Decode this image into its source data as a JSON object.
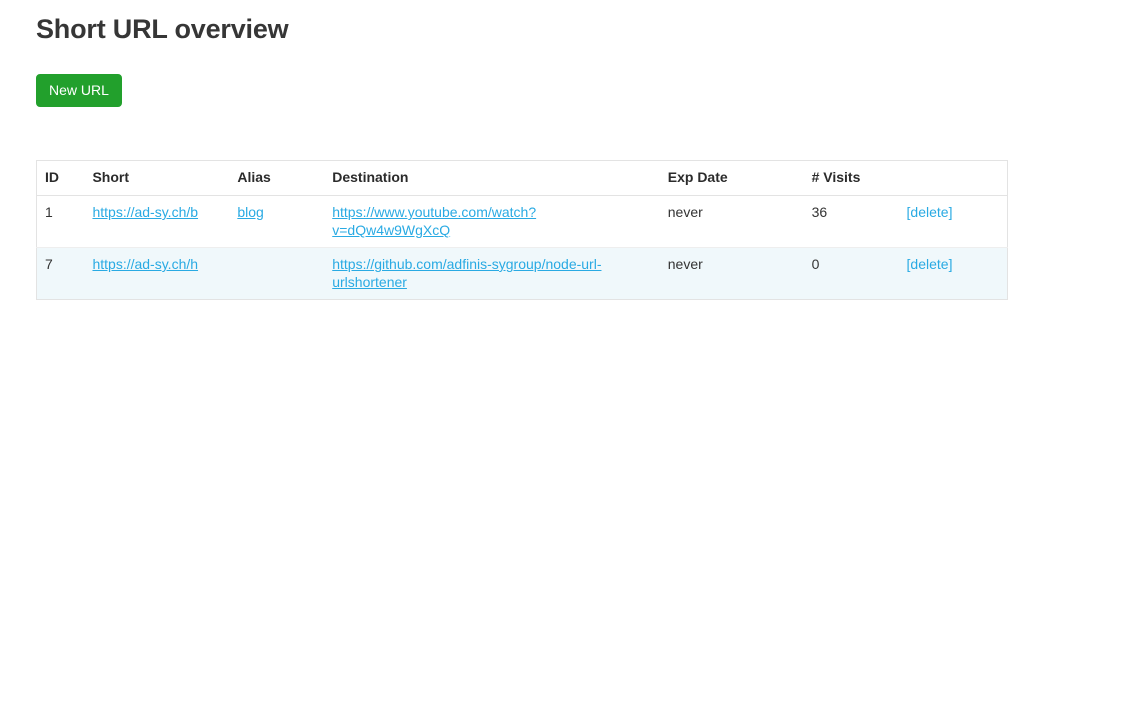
{
  "page": {
    "title": "Short URL overview"
  },
  "toolbar": {
    "new_url_label": "New URL"
  },
  "colors": {
    "button_green": "#22a02c",
    "link_blue": "#29aae3",
    "title_gray": "#363636",
    "row_alt_background": "#f0f8fb",
    "table_border": "#e3e3e3"
  },
  "table": {
    "columns": [
      {
        "key": "id",
        "label": "ID"
      },
      {
        "key": "short",
        "label": "Short"
      },
      {
        "key": "alias",
        "label": "Alias"
      },
      {
        "key": "dest",
        "label": "Destination"
      },
      {
        "key": "exp",
        "label": "Exp Date"
      },
      {
        "key": "visits",
        "label": "# Visits"
      },
      {
        "key": "actions",
        "label": ""
      }
    ],
    "rows": [
      {
        "id": "1",
        "short": "https://ad-sy.ch/b",
        "alias": "blog",
        "dest": "https://www.youtube.com/watch?v=dQw4w9WgXcQ",
        "exp": "never",
        "visits": "36",
        "delete_label": "[delete]"
      },
      {
        "id": "7",
        "short": "https://ad-sy.ch/h",
        "alias": "",
        "dest": "https://github.com/adfinis-sygroup/node-url-urlshortener",
        "exp": "never",
        "visits": "0",
        "delete_label": "[delete]"
      }
    ]
  }
}
